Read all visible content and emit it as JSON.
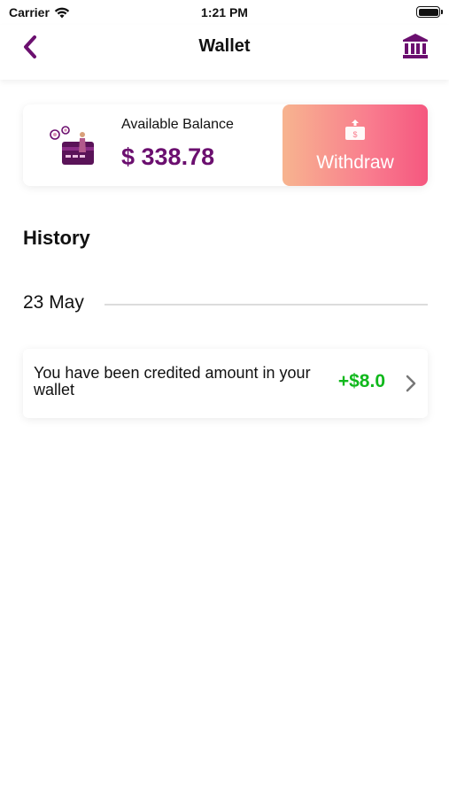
{
  "status_bar": {
    "carrier": "Carrier",
    "time": "1:21 PM"
  },
  "nav": {
    "title": "Wallet",
    "back_icon": "chevron-left-icon",
    "bank_icon": "bank-icon"
  },
  "balance": {
    "label": "Available Balance",
    "amount": "$ 338.78",
    "withdraw_label": "Withdraw",
    "accent_color": "#6b0f6f"
  },
  "history": {
    "title": "History",
    "groups": [
      {
        "date": "23 May",
        "items": [
          {
            "description": "You have been credited amount in your wallet",
            "amount": "+$8.0",
            "amount_color": "#10b81c"
          }
        ]
      }
    ]
  }
}
